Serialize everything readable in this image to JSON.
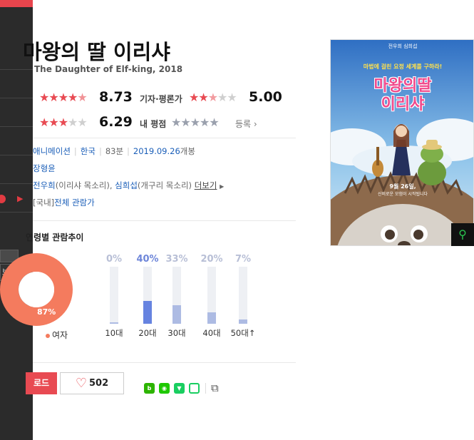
{
  "movie": {
    "title": "마왕의 딸 이리샤",
    "subtitle": "The Daughter of Elf-king, 2018"
  },
  "ratings": {
    "netizen_score": "8.73",
    "critic_label": "기자·평론가",
    "critic_score": "5.00",
    "viewer_score": "6.29",
    "my_rating_label": "내 평점",
    "register_label": "등록"
  },
  "info": {
    "genre": "애니메이션",
    "country": "한국",
    "runtime": "83분",
    "release": "2019.09.26",
    "release_suffix": "개봉",
    "director": "장형윤",
    "cast_1": "전우희",
    "cast_1_role": "(이리샤 목소리)",
    "cast_2": "심희섭",
    "cast_2_role": "(개구리 목소리)",
    "more_label": "더보기",
    "rating_prefix": "[국내]",
    "rating": "전체 관람가"
  },
  "audience": {
    "section_title": "연령별 관람추이",
    "gender_percent": "87%",
    "gender_legend": "여자",
    "age_groups": [
      {
        "label": "10대",
        "pct": "0%",
        "value": 0.01
      },
      {
        "label": "20대",
        "pct": "40%",
        "value": 0.4
      },
      {
        "label": "30대",
        "pct": "33%",
        "value": 0.33
      },
      {
        "label": "40대",
        "pct": "20%",
        "value": 0.2
      },
      {
        "label": "50대↑",
        "pct": "7%",
        "value": 0.07
      }
    ]
  },
  "actions": {
    "download_label": "로드",
    "like_count": "502"
  },
  "sidebar": {
    "view_label": "보기"
  },
  "poster": {
    "top_text": "전우희 심희섭",
    "tagline": "마법에 걸린 요정 세계를 구하라!",
    "title_line1": "마왕의딸",
    "title_line2": "이리샤",
    "date_text": "9월 26일,",
    "date_sub": "신비로운 모험이 시작됩니다"
  },
  "colors": {
    "accent": "#e84a52",
    "bar_highlight": "#6683e0",
    "bar": "#adbbe3",
    "donut": "#f47b5e"
  }
}
